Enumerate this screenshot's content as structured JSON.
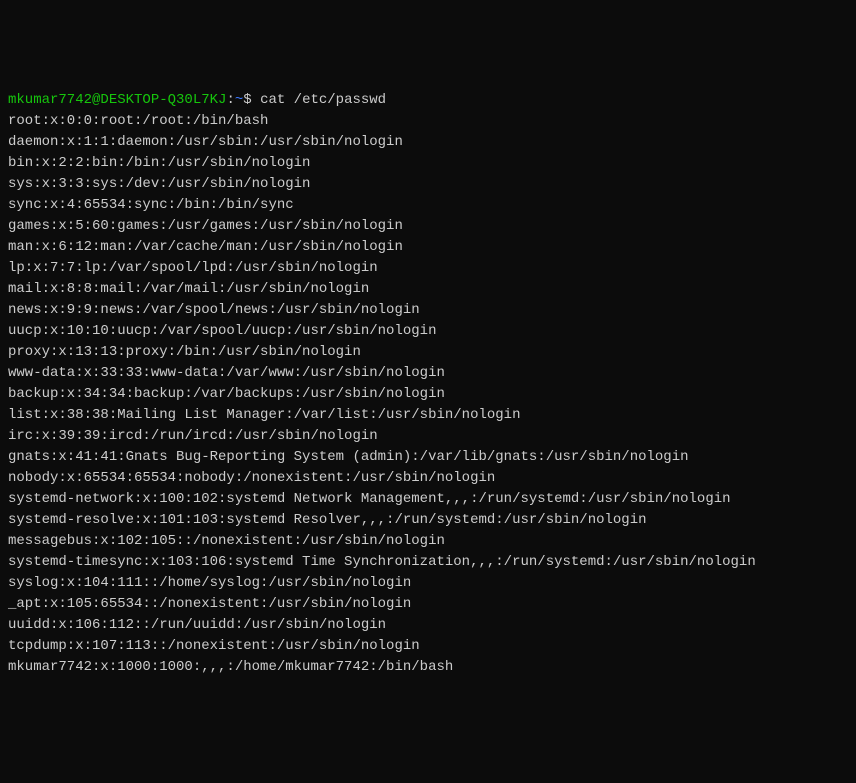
{
  "prompt": {
    "user_host": "mkumar7742@DESKTOP-Q30L7KJ",
    "path": "~",
    "symbol": "$",
    "command": "cat /etc/passwd"
  },
  "lines": [
    "root:x:0:0:root:/root:/bin/bash",
    "daemon:x:1:1:daemon:/usr/sbin:/usr/sbin/nologin",
    "bin:x:2:2:bin:/bin:/usr/sbin/nologin",
    "sys:x:3:3:sys:/dev:/usr/sbin/nologin",
    "sync:x:4:65534:sync:/bin:/bin/sync",
    "games:x:5:60:games:/usr/games:/usr/sbin/nologin",
    "man:x:6:12:man:/var/cache/man:/usr/sbin/nologin",
    "lp:x:7:7:lp:/var/spool/lpd:/usr/sbin/nologin",
    "mail:x:8:8:mail:/var/mail:/usr/sbin/nologin",
    "news:x:9:9:news:/var/spool/news:/usr/sbin/nologin",
    "uucp:x:10:10:uucp:/var/spool/uucp:/usr/sbin/nologin",
    "proxy:x:13:13:proxy:/bin:/usr/sbin/nologin",
    "www-data:x:33:33:www-data:/var/www:/usr/sbin/nologin",
    "backup:x:34:34:backup:/var/backups:/usr/sbin/nologin",
    "list:x:38:38:Mailing List Manager:/var/list:/usr/sbin/nologin",
    "irc:x:39:39:ircd:/run/ircd:/usr/sbin/nologin",
    "gnats:x:41:41:Gnats Bug-Reporting System (admin):/var/lib/gnats:/usr/sbin/nologin",
    "nobody:x:65534:65534:nobody:/nonexistent:/usr/sbin/nologin",
    "systemd-network:x:100:102:systemd Network Management,,,:/run/systemd:/usr/sbin/nologin",
    "systemd-resolve:x:101:103:systemd Resolver,,,:/run/systemd:/usr/sbin/nologin",
    "messagebus:x:102:105::/nonexistent:/usr/sbin/nologin",
    "systemd-timesync:x:103:106:systemd Time Synchronization,,,:/run/systemd:/usr/sbin/nologin",
    "syslog:x:104:111::/home/syslog:/usr/sbin/nologin",
    "_apt:x:105:65534::/nonexistent:/usr/sbin/nologin",
    "uuidd:x:106:112::/run/uuidd:/usr/sbin/nologin",
    "tcpdump:x:107:113::/nonexistent:/usr/sbin/nologin",
    "mkumar7742:x:1000:1000:,,,:/home/mkumar7742:/bin/bash"
  ]
}
